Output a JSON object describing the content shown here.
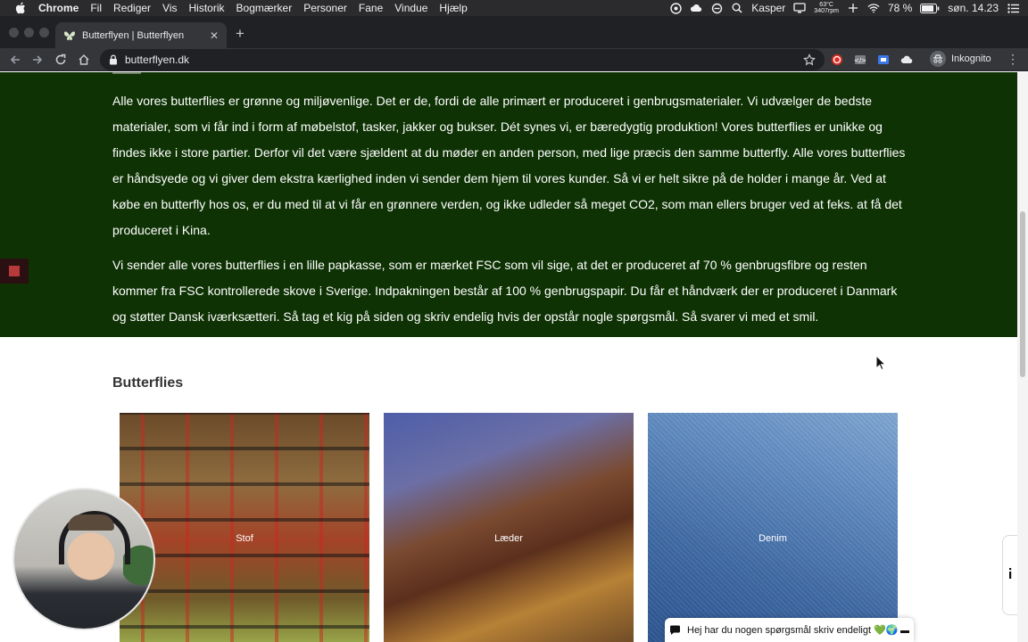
{
  "menubar": {
    "app_name": "Chrome",
    "items": [
      "Fil",
      "Rediger",
      "Vis",
      "Historik",
      "Bogmærker",
      "Personer",
      "Fane",
      "Vindue",
      "Hjælp"
    ],
    "user": "Kasper",
    "temp": "63°C",
    "rpm": "3407rpm",
    "battery": "78 %",
    "clock": "søn. 14.23"
  },
  "browser": {
    "tab_title": "Butterflyen | Butterflyen",
    "url": "butterflyen.dk",
    "profile_label": "Inkognito"
  },
  "page": {
    "paragraph_1": "Alle vores butterflies er grønne og miljøvenlige. Det er de, fordi de alle primært er produceret i genbrugsmaterialer. Vi udvælger de bedste materialer, som vi får ind i form af møbelstof, tasker, jakker og bukser.  Dét synes vi, er bæredygtig produktion! Vores butterflies er unikke og findes ikke i store partier. Derfor vil det være sjældent at du møder en anden person, med lige præcis den samme butterfly.  Alle vores butterflies er håndsyede og vi giver dem ekstra kærlighed inden vi sender dem hjem til vores kunder. Så vi er helt sikre på de holder i mange år. Ved at købe en butterfly hos os, er du med til at vi får en grønnere verden, og ikke udleder så meget CO2, som man ellers bruger ved at feks. at få det produceret i Kina.",
    "paragraph_2": "Vi sender alle vores butterflies i en lille papkasse, som er mærket FSC som vil sige, at det er produceret af 70 % genbrugsfibre og resten kommer fra FSC kontrollerede skove i Sverige. Indpakningen består af 100 % genbrugspapir. Du får et håndværk der er produceret i Danmark og støtter Dansk iværksætteri. Så tag et kig på siden og skriv endelig hvis der opstår nogle spørgsmål. Så svarer vi med et smil.",
    "section_title": "Butterflies",
    "categories": [
      {
        "label": "Stof"
      },
      {
        "label": "Læder"
      },
      {
        "label": "Denim"
      }
    ],
    "chat_prompt": "Hej har du nogen spørgsmål skriv endeligt 💚🌍"
  },
  "colors": {
    "green_section_bg": "#0e3204",
    "chrome_dark": "#202124",
    "chrome_toolbar": "#35363a"
  },
  "icons": {
    "apple": "apple-icon",
    "wifi": "wifi-icon",
    "battery": "battery-icon",
    "search": "search-icon",
    "lock": "lock-icon",
    "star": "star-icon",
    "chat": "chat-icon",
    "info": "info-icon"
  }
}
